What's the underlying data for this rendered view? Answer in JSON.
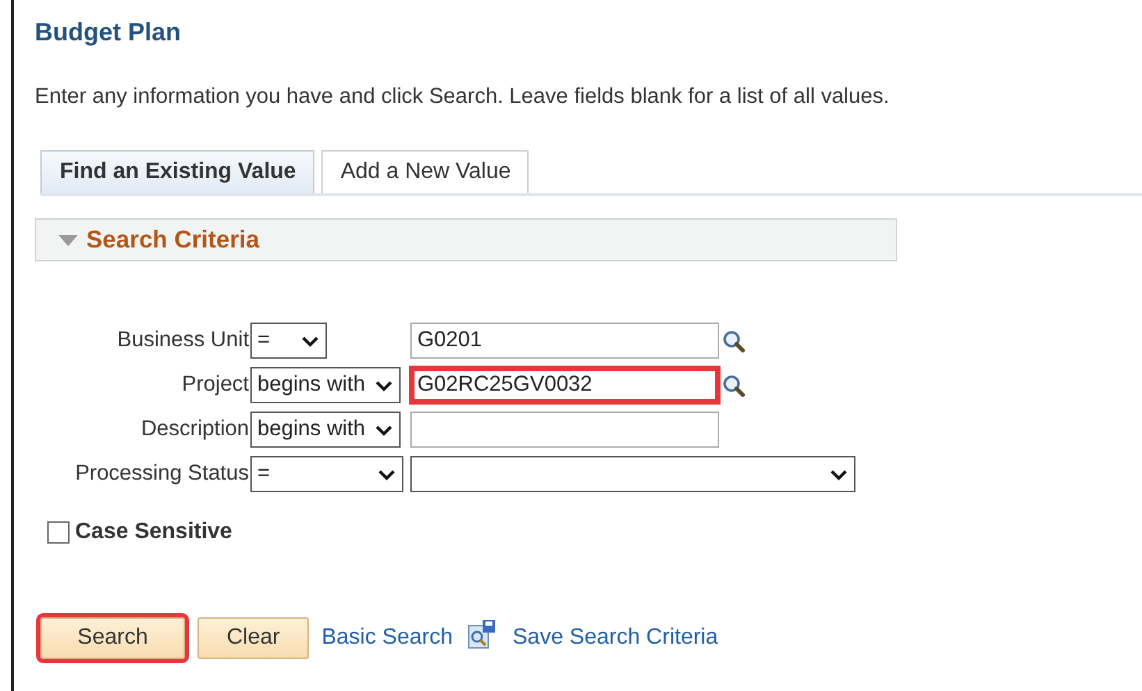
{
  "page_title": "Budget Plan",
  "instructions": "Enter any information you have and click Search. Leave fields blank for a list of all values.",
  "tabs": [
    {
      "label": "Find an Existing Value",
      "selected": true
    },
    {
      "label": "Add a New Value",
      "selected": false
    }
  ],
  "section": {
    "title": "Search Criteria",
    "expanded": true
  },
  "criteria": [
    {
      "label": "Business Unit",
      "operator": "=",
      "kind": "lookup",
      "value": "G0201",
      "highlighted": false
    },
    {
      "label": "Project",
      "operator": "begins with",
      "kind": "lookup",
      "value": "G02RC25GV0032",
      "highlighted": true
    },
    {
      "label": "Description",
      "operator": "begins with",
      "kind": "text",
      "highlighted": false
    },
    {
      "label": "Processing Status",
      "operator": "=",
      "kind": "dropdown",
      "highlighted": false
    }
  ],
  "case_sensitive": {
    "label": "Case Sensitive",
    "checked": false
  },
  "buttons": [
    {
      "label": "Search",
      "highlighted": true
    },
    {
      "label": "Clear",
      "highlighted": false
    }
  ],
  "links": [
    {
      "label": "Basic Search",
      "kind": "text"
    },
    {
      "label": "Save Search Criteria",
      "kind": "icon"
    }
  ]
}
